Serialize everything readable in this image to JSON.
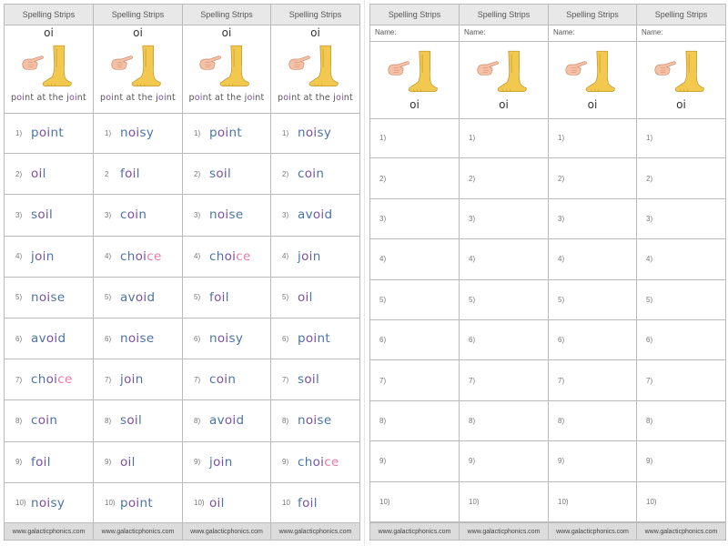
{
  "strip_title": "Spelling Strips",
  "footer_url": "www.galacticphonics.com",
  "sound": "oi",
  "mnemonic": "point at the joint",
  "name_label": "Name:",
  "icons": [
    "pointing-hand-icon",
    "leg-and-foot-icon"
  ],
  "colors": {
    "word": "#4a74a8",
    "phoneme": "#7a4fa3",
    "silent_e": "#e87aa8",
    "leg": "#f3c84e"
  },
  "left_strips": [
    {
      "rows": [
        {
          "num": "1)",
          "word": "point"
        },
        {
          "num": "2)",
          "word": "oil"
        },
        {
          "num": "3)",
          "word": "soil"
        },
        {
          "num": "4)",
          "word": "join"
        },
        {
          "num": "5)",
          "word": "noise"
        },
        {
          "num": "6)",
          "word": "avoid"
        },
        {
          "num": "7)",
          "word": "choice"
        },
        {
          "num": "8)",
          "word": "coin"
        },
        {
          "num": "9)",
          "word": "foil"
        },
        {
          "num": "10)",
          "word": "noisy"
        }
      ]
    },
    {
      "rows": [
        {
          "num": "1)",
          "word": "noisy"
        },
        {
          "num": "2",
          "word": "foil"
        },
        {
          "num": "3)",
          "word": "coin"
        },
        {
          "num": "4)",
          "word": "choice"
        },
        {
          "num": "5)",
          "word": "avoid"
        },
        {
          "num": "6)",
          "word": "noise"
        },
        {
          "num": "7)",
          "word": "join"
        },
        {
          "num": "8)",
          "word": "soil"
        },
        {
          "num": "9)",
          "word": "oil"
        },
        {
          "num": "10)",
          "word": "point"
        }
      ]
    },
    {
      "rows": [
        {
          "num": "1)",
          "word": "point"
        },
        {
          "num": "2)",
          "word": "soil"
        },
        {
          "num": "3)",
          "word": "noise"
        },
        {
          "num": "4)",
          "word": "choice"
        },
        {
          "num": "5)",
          "word": "foil"
        },
        {
          "num": "6)",
          "word": "noisy"
        },
        {
          "num": "7)",
          "word": "coin"
        },
        {
          "num": "8)",
          "word": "avoid"
        },
        {
          "num": "9)",
          "word": "join"
        },
        {
          "num": "10)",
          "word": "oil"
        }
      ]
    },
    {
      "rows": [
        {
          "num": "1)",
          "word": "noisy"
        },
        {
          "num": "2)",
          "word": "coin"
        },
        {
          "num": "3)",
          "word": "avoid"
        },
        {
          "num": "4)",
          "word": "join"
        },
        {
          "num": "5)",
          "word": "oil"
        },
        {
          "num": "6)",
          "word": "point"
        },
        {
          "num": "7)",
          "word": "soil"
        },
        {
          "num": "8)",
          "word": "noise"
        },
        {
          "num": "9)",
          "word": "choice"
        },
        {
          "num": "10",
          "word": "foil"
        }
      ]
    }
  ],
  "right_numbers": [
    "1)",
    "2)",
    "3)",
    "4)",
    "5)",
    "6)",
    "7)",
    "8)",
    "9)",
    "10)"
  ]
}
